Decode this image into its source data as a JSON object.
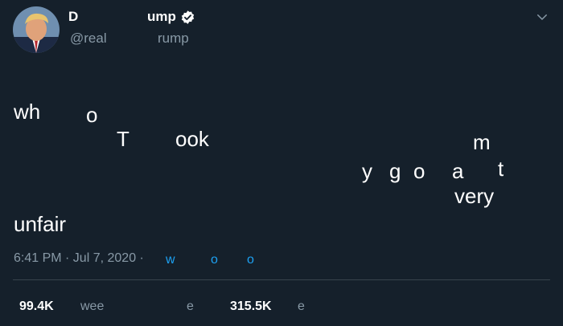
{
  "header": {
    "display_name_part1": "D",
    "display_name_part2": "ump",
    "handle_part1": "@real",
    "handle_part2": "rump"
  },
  "tweet": {
    "words": [
      "wh",
      "o",
      "T",
      "ook",
      "m",
      "y",
      "g",
      "o",
      "a",
      "t",
      "very",
      "unfair"
    ]
  },
  "meta": {
    "time": "6:41 PM · Jul  7, 2020 ·",
    "source_parts": [
      "w",
      "o",
      "o"
    ]
  },
  "stats": {
    "retweets_count": "99.4K",
    "retweets_label": "wee",
    "quote_label": "e",
    "likes_count": "315.5K",
    "likes_label": "e"
  },
  "colors": {
    "background": "#15202b",
    "text": "#ffffff",
    "secondary": "#8899a6",
    "accent": "#1da1f2",
    "divider": "#38444d"
  },
  "icons": {
    "verified": "verified-badge-icon",
    "menu": "chevron-down-icon"
  }
}
